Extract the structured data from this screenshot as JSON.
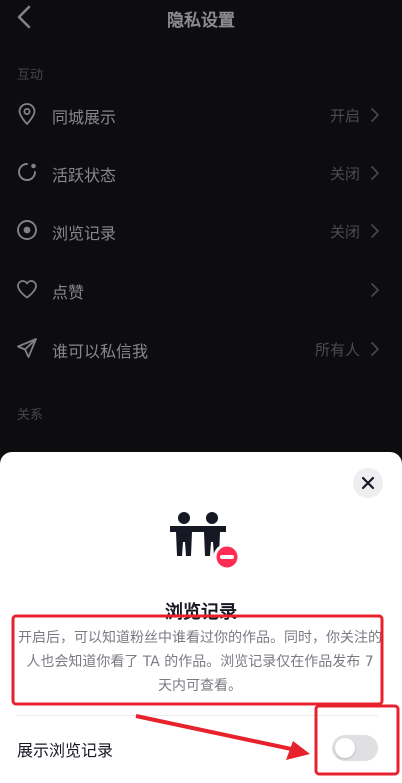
{
  "header": {
    "title": "隐私设置"
  },
  "sections": {
    "interaction": "互动",
    "relation": "关系"
  },
  "rows": [
    {
      "label": "同城展示",
      "value": "开启",
      "icon": "location-pin-icon"
    },
    {
      "label": "活跃状态",
      "value": "关闭",
      "icon": "activity-status-icon"
    },
    {
      "label": "浏览记录",
      "value": "关闭",
      "icon": "eye-icon"
    },
    {
      "label": "点赞",
      "value": "",
      "icon": "heart-icon"
    },
    {
      "label": "谁可以私信我",
      "value": "所有人",
      "icon": "send-icon"
    }
  ],
  "sheet": {
    "title": "浏览记录",
    "description": "开启后，可以知道粉丝中谁看过你的作品。同时，你关注的人也会知道你看了 TA 的作品。浏览记录仅在作品发布 7 天内可查看。",
    "toggle_label": "展示浏览记录",
    "toggle_on": false
  },
  "colors": {
    "background": "#141419",
    "sheet": "#ffffff",
    "annotation": "#e8222d",
    "badge": "#fe2c55"
  }
}
